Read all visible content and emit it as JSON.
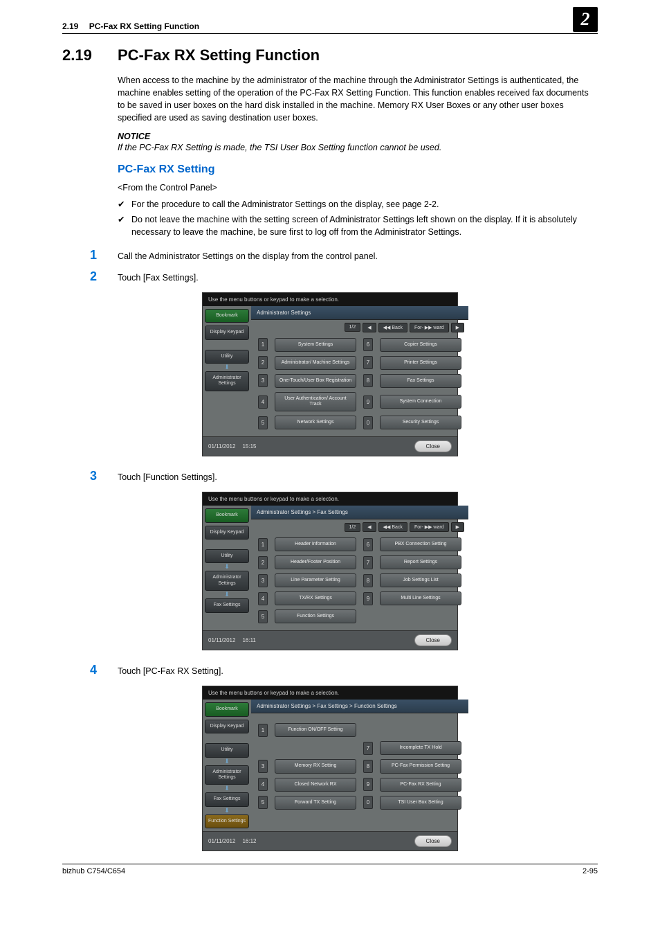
{
  "header": {
    "section_num": "2.19",
    "section_title": "PC-Fax RX Setting Function",
    "chapter": "2"
  },
  "title": {
    "num": "2.19",
    "text": "PC-Fax RX Setting Function"
  },
  "intro": "When access to the machine by the administrator of the machine through the Administrator Settings is authenticated, the machine enables setting of the operation of the PC-Fax RX Setting Function. This function enables received fax documents to be saved in user boxes on the hard disk installed in the machine. Memory RX User Boxes or any other user boxes specified are used as saving destination user boxes.",
  "notice_label": "NOTICE",
  "notice_text": "If the PC-Fax RX Setting is made, the TSI User Box Setting function cannot be used.",
  "sub_heading": "PC-Fax RX Setting",
  "from_cp": "<From the Control Panel>",
  "bullets": [
    "For the procedure to call the Administrator Settings on the display, see page 2-2.",
    "Do not leave the machine with the setting screen of Administrator Settings left shown on the display. If it is absolutely necessary to leave the machine, be sure first to log off from the Administrator Settings."
  ],
  "steps": {
    "s1": {
      "num": "1",
      "text": "Call the Administrator Settings on the display from the control panel."
    },
    "s2": {
      "num": "2",
      "text": "Touch [Fax Settings]."
    },
    "s3": {
      "num": "3",
      "text": "Touch [Function Settings]."
    },
    "s4": {
      "num": "4",
      "text": "Touch [PC-Fax RX Setting]."
    }
  },
  "panel_common": {
    "hint": "Use the menu buttons or keypad to make a selection.",
    "bookmark": "Bookmark",
    "display_keypad": "Display Keypad",
    "utility": "Utility",
    "admin": "Administrator Settings",
    "fax_settings": "Fax Settings",
    "function_settings": "Function Settings",
    "page": "1/2",
    "back": "◀◀ Back",
    "fwd": "For- ▶▶ ward",
    "close": "Close"
  },
  "panel1": {
    "breadcrumb": "Administrator Settings",
    "items": {
      "1": "System Settings",
      "6": "Copier Settings",
      "2": "Administrator/ Machine Settings",
      "7": "Printer Settings",
      "3": "One-Touch/User Box Registration",
      "8": "Fax Settings",
      "4": "User Authentication/ Account Track",
      "9": "System Connection",
      "5": "Network Settings",
      "0": "Security Settings"
    },
    "date": "01/11/2012",
    "time": "15:15"
  },
  "panel2": {
    "breadcrumb": "Administrator Settings  >  Fax Settings",
    "items": {
      "1": "Header Information",
      "6": "PBX Connection Setting",
      "2": "Header/Footer Position",
      "7": "Report Settings",
      "3": "Line Parameter Setting",
      "8": "Job Settings List",
      "4": "TX/RX Settings",
      "9": "Multi Line Settings",
      "5": "Function Settings"
    },
    "date": "01/11/2012",
    "time": "16:11"
  },
  "panel3": {
    "breadcrumb": "Administrator Settings > Fax Settings > Function Settings",
    "items": {
      "1": "Function ON/OFF Setting",
      "7": "Incomplete TX Hold",
      "3": "Memory RX Setting",
      "8": "PC-Fax Permission Setting",
      "4": "Closed Network RX",
      "9": "PC-Fax RX Setting",
      "5": "Forward TX Setting",
      "0": "TSI User Box Setting"
    },
    "date": "01/11/2012",
    "time": "16:12"
  },
  "footer": {
    "left": "bizhub C754/C654",
    "right": "2-95"
  }
}
